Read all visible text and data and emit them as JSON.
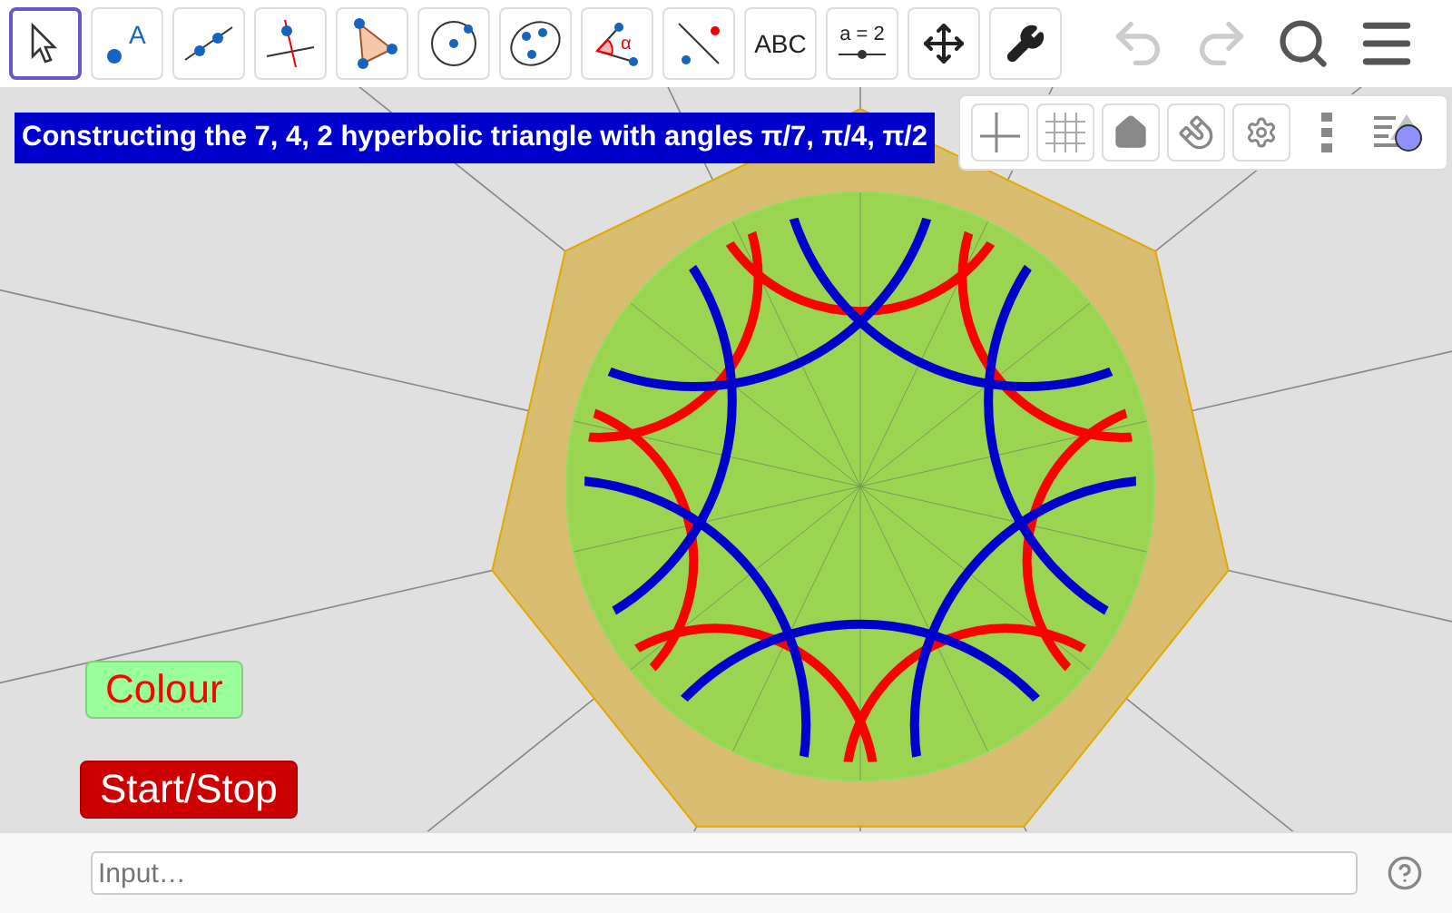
{
  "toolbar": {
    "tools": [
      {
        "kind": "move",
        "selected": true
      },
      {
        "kind": "point",
        "label": "A",
        "selected": false
      },
      {
        "kind": "line",
        "selected": false
      },
      {
        "kind": "perpendicular",
        "selected": false
      },
      {
        "kind": "polygon",
        "selected": false
      },
      {
        "kind": "circle",
        "selected": false
      },
      {
        "kind": "conic",
        "selected": false
      },
      {
        "kind": "angle",
        "label": "α",
        "selected": false
      },
      {
        "kind": "reflect",
        "selected": false
      },
      {
        "kind": "text",
        "label": "ABC",
        "selected": false
      },
      {
        "kind": "slider",
        "label": "a = 2",
        "selected": false
      },
      {
        "kind": "pan",
        "selected": false
      },
      {
        "kind": "tools",
        "selected": false
      }
    ],
    "undo": {
      "disabled": true
    },
    "redo": {
      "disabled": true
    }
  },
  "graphics": {
    "title": "Constructing the 7, 4, 2 hyperbolic triangle with angles π/7, π/4, π/2",
    "buttons": [
      {
        "label": "Colour",
        "kind": "colour"
      },
      {
        "label": "Start/Stop",
        "kind": "start"
      }
    ]
  },
  "input_bar": {
    "placeholder": "Input…"
  }
}
